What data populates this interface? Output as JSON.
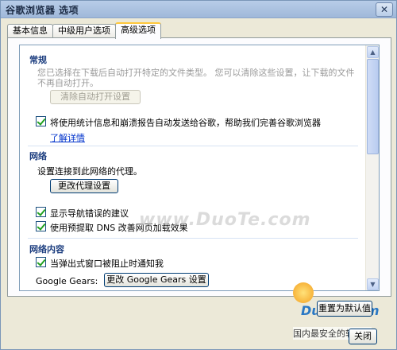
{
  "window": {
    "title": "谷歌浏览器 选项",
    "close_glyph": "✕"
  },
  "tabs": [
    {
      "label": "基本信息"
    },
    {
      "label": "中级用户选项"
    },
    {
      "label": "高级选项"
    }
  ],
  "sections": {
    "general": {
      "title": "常规",
      "desc": "您已选择在下载后自动打开特定的文件类型。 您可以清除这些设置，让下载的文件不再自动打开。",
      "clear_button": "清除自动打开设置",
      "stats_checkbox_label": "将使用统计信息和崩溃报告自动发送给谷歌，帮助我们完善谷歌浏览器",
      "learn_more": "了解详情"
    },
    "network": {
      "title": "网络",
      "desc": "设置连接到此网络的代理。",
      "proxy_button": "更改代理设置",
      "nav_error_label": "显示导航错误的建议",
      "dns_prefetch_label": "使用预提取 DNS 改善网页加载效果"
    },
    "web_content": {
      "title": "网络内容",
      "popup_label": "当弹出式窗口被阻止时通知我",
      "gears_label": "Google Gears:",
      "gears_button": "更改 Google Gears 设置"
    }
  },
  "footer": {
    "reset_button": "重置为默认值",
    "close_button": "关闭"
  },
  "watermark": "www.DuoTe.com",
  "logo": {
    "brand": "DuoTe.com",
    "slogan": "国内最安全的软件站"
  },
  "icons": {
    "scroll_up": "▲",
    "scroll_down": "▼"
  },
  "colors": {
    "section_title": "#1e3f80",
    "link": "#0033cc",
    "check": "#21a121",
    "tab_highlight": "#ffc83c"
  }
}
